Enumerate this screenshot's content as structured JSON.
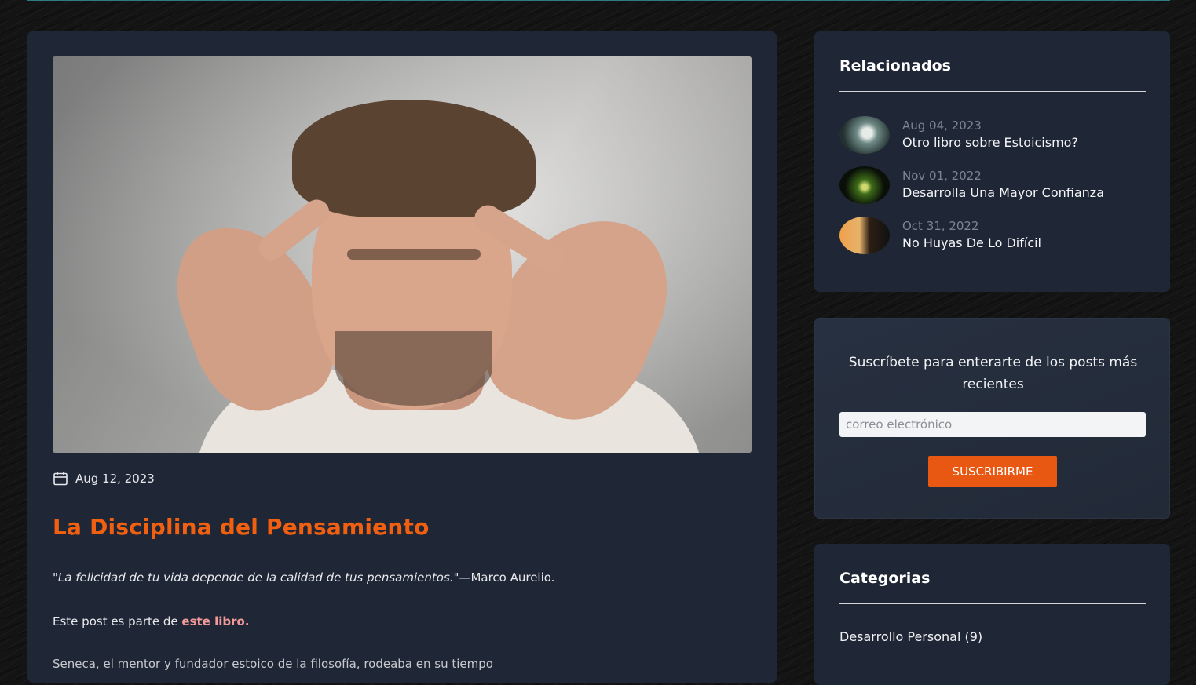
{
  "post": {
    "image_alt": "man with fingers on temples concentrating",
    "date": "Aug 12, 2023",
    "title": "La Disciplina del Pensamiento",
    "quote": "\"La felicidad de tu vida depende de la calidad de tus pensamientos.\"",
    "quote_author": "—Marco Aurelio.",
    "part_of_prefix": "Este post es parte de ",
    "part_of_link": "este libro.",
    "next_paragraph": "Seneca, el mentor y fundador estoico de la filosofía, rodeaba en su tiempo"
  },
  "related": {
    "title": "Relacionados",
    "items": [
      {
        "date": "Aug 04, 2023",
        "title": "Otro libro sobre Estoicismo?",
        "thumb": "statue-thumb"
      },
      {
        "date": "Nov 01, 2022",
        "title": "Desarrolla Una Mayor Confianza",
        "thumb": "green-light-thumb"
      },
      {
        "date": "Oct 31, 2022",
        "title": "No Huyas De Lo Difícil",
        "thumb": "sunset-climber-thumb"
      }
    ]
  },
  "subscribe": {
    "text": "Suscríbete para enterarte de los posts más recientes",
    "placeholder": "correo electrónico",
    "button": "SUSCRIBIRME"
  },
  "categories": {
    "title": "Categorias",
    "items": [
      {
        "label": "Desarrollo Personal (9)"
      }
    ]
  },
  "colors": {
    "accent": "#f06010",
    "button": "#e95812",
    "card": "#1f2636",
    "link": "#f39a9a"
  }
}
